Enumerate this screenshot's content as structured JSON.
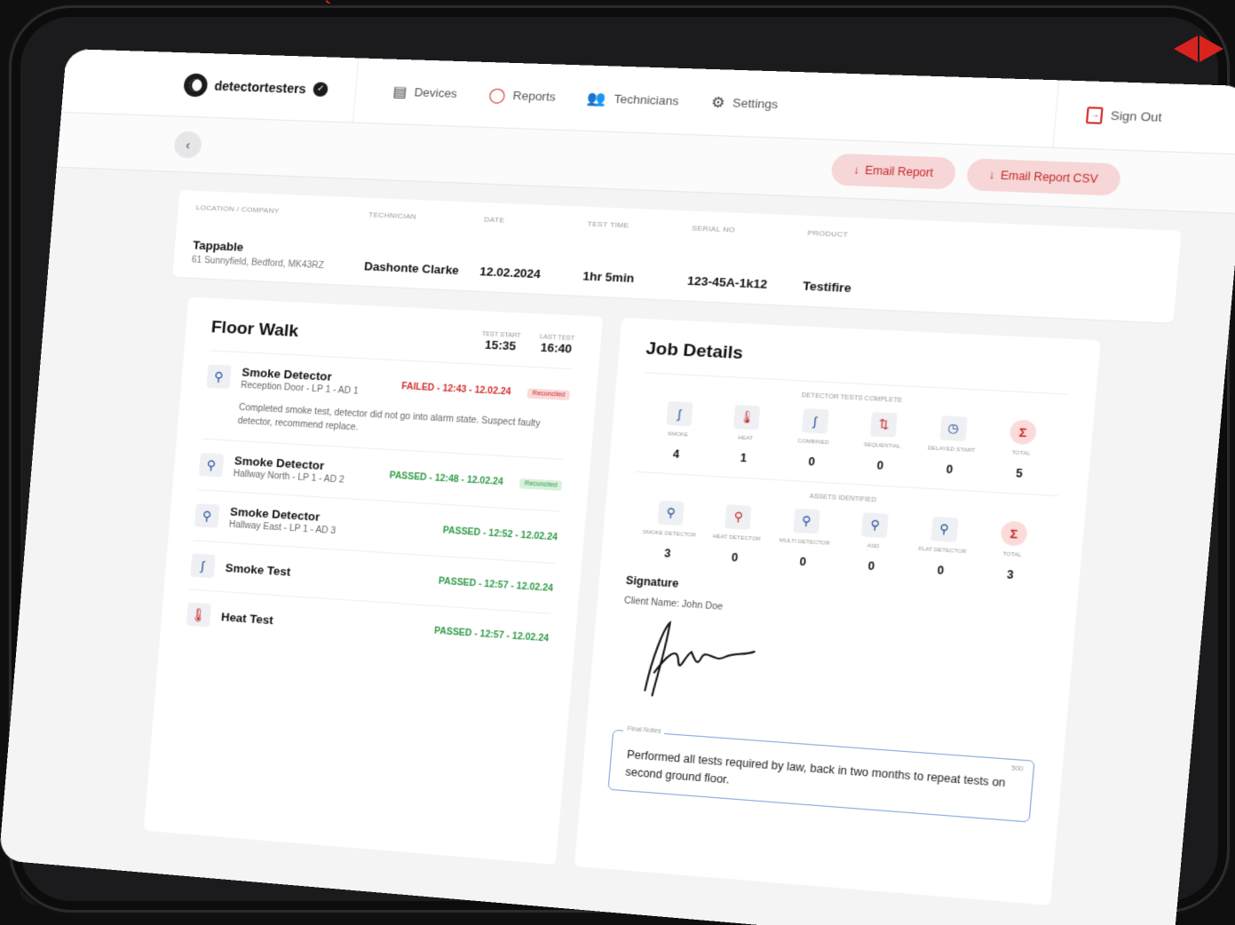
{
  "brand": {
    "name": "detectortesters"
  },
  "nav": [
    {
      "label": "Devices",
      "icon": "clipboard-icon"
    },
    {
      "label": "Reports",
      "icon": "report-ring-icon"
    },
    {
      "label": "Technicians",
      "icon": "people-icon"
    },
    {
      "label": "Settings",
      "icon": "gear-icon"
    }
  ],
  "signout": {
    "label": "Sign Out"
  },
  "actions": {
    "email_report": "Email Report",
    "email_report_csv": "Email Report CSV"
  },
  "meta": {
    "headers": [
      "LOCATION / COMPANY",
      "TECHNICIAN",
      "DATE",
      "TEST TIME",
      "SERIAL NO",
      "PRODUCT"
    ],
    "location": "Tappable",
    "address": "61 Sunnyfield, Bedford, MK43RZ",
    "technician": "Dashonte Clarke",
    "date": "12.02.2024",
    "test_time": "1hr 5min",
    "serial": "123-45A-1k12",
    "product": "Testifire"
  },
  "floor_walk": {
    "title": "Floor Walk",
    "test_start_label": "TEST START",
    "test_start": "15:35",
    "last_test_label": "LAST TEST",
    "last_test": "16:40",
    "items": [
      {
        "name": "Smoke Detector",
        "location": "Reception Door - LP 1 - AD 1",
        "status": "FAILED - 12:43 - 12.02.24",
        "tag": "Reconciled",
        "note": "Completed smoke test, detector did not go into alarm state. Suspect faulty detector, recommend replace."
      },
      {
        "name": "Smoke Detector",
        "location": "Hallway North - LP 1 - AD 2",
        "status": "PASSED - 12:48 - 12.02.24",
        "tag": "Reconciled"
      },
      {
        "name": "Smoke Detector",
        "location": "Hallway East - LP 1 - AD 3",
        "status": "PASSED - 12:52 - 12.02.24"
      },
      {
        "name": "Smoke Test",
        "status": "PASSED - 12:57 - 12.02.24"
      },
      {
        "name": "Heat Test",
        "status": "PASSED - 12:57 - 12.02.24"
      }
    ]
  },
  "job_details": {
    "title": "Job Details",
    "tests_title": "DETECTOR TESTS COMPLETE",
    "tests": [
      {
        "label": "SMOKE",
        "value": "4"
      },
      {
        "label": "HEAT",
        "value": "1"
      },
      {
        "label": "COMBINED",
        "value": "0"
      },
      {
        "label": "SEQUENTIAL",
        "value": "0"
      },
      {
        "label": "DELAYED START",
        "value": "0"
      },
      {
        "label": "TOTAL",
        "value": "5"
      }
    ],
    "assets_title": "ASSETS IDENTIFIED",
    "assets": [
      {
        "label": "SMOKE DETECTOR",
        "value": "3"
      },
      {
        "label": "HEAT DETECTOR",
        "value": "0"
      },
      {
        "label": "MULTI DETECTOR",
        "value": "0"
      },
      {
        "label": "ASD",
        "value": "0"
      },
      {
        "label": "FLAT DETECTOR",
        "value": "0"
      },
      {
        "label": "TOTAL",
        "value": "3"
      }
    ],
    "signature_title": "Signature",
    "client_name": "Client Name: John Doe",
    "notes_label": "Final Notes",
    "notes_count": "500",
    "notes": "Performed all tests required by law, back in two months to repeat tests on second ground floor."
  },
  "colors": {
    "accent": "#d32f2f",
    "pass": "#2e9a45",
    "fail": "#d32f2f",
    "icon_blue": "#1f4a9c"
  }
}
